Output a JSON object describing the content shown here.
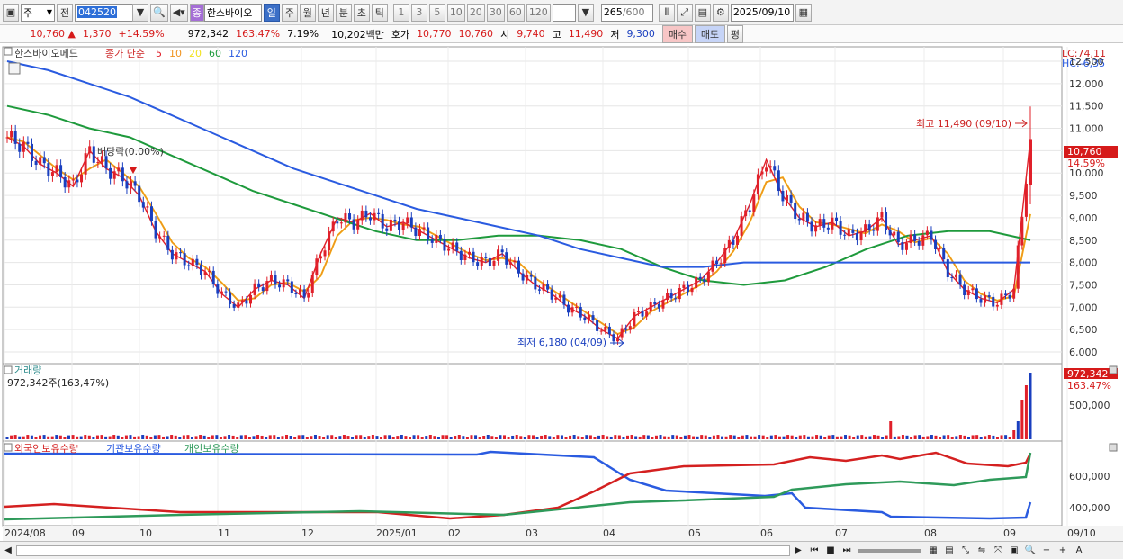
{
  "toolbar": {
    "market": "주",
    "prev_label": "전",
    "code": "042520",
    "name": "한스바이오",
    "name_badge": "종",
    "periods": [
      "일",
      "주",
      "월",
      "년",
      "분",
      "초",
      "틱"
    ],
    "active_period": "일",
    "intervals": [
      "1",
      "3",
      "5",
      "10",
      "20",
      "30",
      "60",
      "120"
    ],
    "count": "265",
    "count_total": "/600",
    "date": "2025/09/10"
  },
  "quote": {
    "price": "10,760",
    "change": "1,370",
    "change_pct": "+14.59%",
    "volume": "972,342",
    "vol_ratio": "163.47%",
    "turnover_pct": "7.19%",
    "amount": "10,202백만",
    "bid_label": "호가",
    "bid1": "10,770",
    "bid2": "10,760",
    "open_label": "시",
    "open": "9,740",
    "high_label": "고",
    "high": "11,490",
    "low_label": "저",
    "low": "9,300",
    "buy_label": "매수",
    "sell_label": "매도",
    "eval_label": "평"
  },
  "price_panel": {
    "title": "한스바이오메드",
    "ma_label": "종가 단순",
    "ma_periods": [
      "5",
      "10",
      "20",
      "60",
      "120"
    ],
    "lc_label": "LC:74,11",
    "hc_label": "HC:-6,35",
    "y_ticks": [
      "12,500",
      "12,000",
      "11,500",
      "11,000",
      "10,500",
      "10,000",
      "9,500",
      "9,000",
      "8,500",
      "8,000",
      "7,500",
      "7,000",
      "6,500",
      "6,000"
    ],
    "current_price": "10,760",
    "current_pct": "14.59%",
    "high_annot": "최고 11,490 (09/10)",
    "low_annot": "최저 6,180 (04/09)",
    "dividend_annot": "배당락(0.00%)"
  },
  "volume_panel": {
    "title": "거래량",
    "value_label": "972,342주(163,47%)",
    "y_tick": "500,000",
    "current": "972,342",
    "current_pct": "163.47%"
  },
  "holdings_panel": {
    "series": [
      "외국인보유수량",
      "기관보유수량",
      "개인보유수량"
    ],
    "y_ticks": [
      "600,000",
      "400,000"
    ]
  },
  "x_axis": [
    "2024/08",
    "09",
    "10",
    "11",
    "12",
    "2025/01",
    "02",
    "03",
    "04",
    "05",
    "06",
    "07",
    "08",
    "09",
    "09/10"
  ],
  "colors": {
    "ma5": "#e0202a",
    "ma10": "#f0931e",
    "ma20": "#f2e21e",
    "ma60": "#1e9a3c",
    "ma120": "#2a5be0",
    "up": "#e0202a",
    "down": "#1a3fbf",
    "foreign": "#d42020",
    "inst": "#2a5be0",
    "indiv": "#2e9a5a"
  },
  "chart_data": {
    "type": "candlestick",
    "note_series": "approximate values read from chart",
    "close_series": [
      10800,
      10600,
      10200,
      10000,
      9700,
      10500,
      10100,
      9900,
      9500,
      8700,
      8200,
      8000,
      7800,
      7300,
      7000,
      7400,
      7600,
      7500,
      7200,
      8200,
      9000,
      8900,
      9100,
      8800,
      8900,
      8700,
      8500,
      8300,
      8100,
      8000,
      8200,
      7800,
      7500,
      7300,
      7000,
      6800,
      6500,
      6300,
      6800,
      7000,
      7200,
      7400,
      7600,
      8000,
      8500,
      9300,
      10300,
      9500,
      9000,
      8800,
      8900,
      8600,
      8700,
      9000,
      8400,
      8500,
      8600,
      7800,
      7400,
      7200,
      7100,
      7400,
      10760
    ],
    "ma60": [
      11500,
      11300,
      11000,
      10800,
      10400,
      10000,
      9600,
      9300,
      9000,
      8700,
      8500,
      8500,
      8600,
      8600,
      8500,
      8300,
      7900,
      7600,
      7500,
      7600,
      7900,
      8300,
      8600,
      8700,
      8700,
      8500
    ],
    "ma120": [
      12500,
      12300,
      12000,
      11700,
      11300,
      10900,
      10500,
      10100,
      9800,
      9500,
      9200,
      9000,
      8800,
      8600,
      8300,
      8100,
      7900,
      7900,
      8000,
      8000,
      8000,
      8000,
      8000,
      8000,
      8000,
      8000
    ],
    "volume_last": 972342,
    "y_range": [
      6000,
      12500
    ]
  }
}
